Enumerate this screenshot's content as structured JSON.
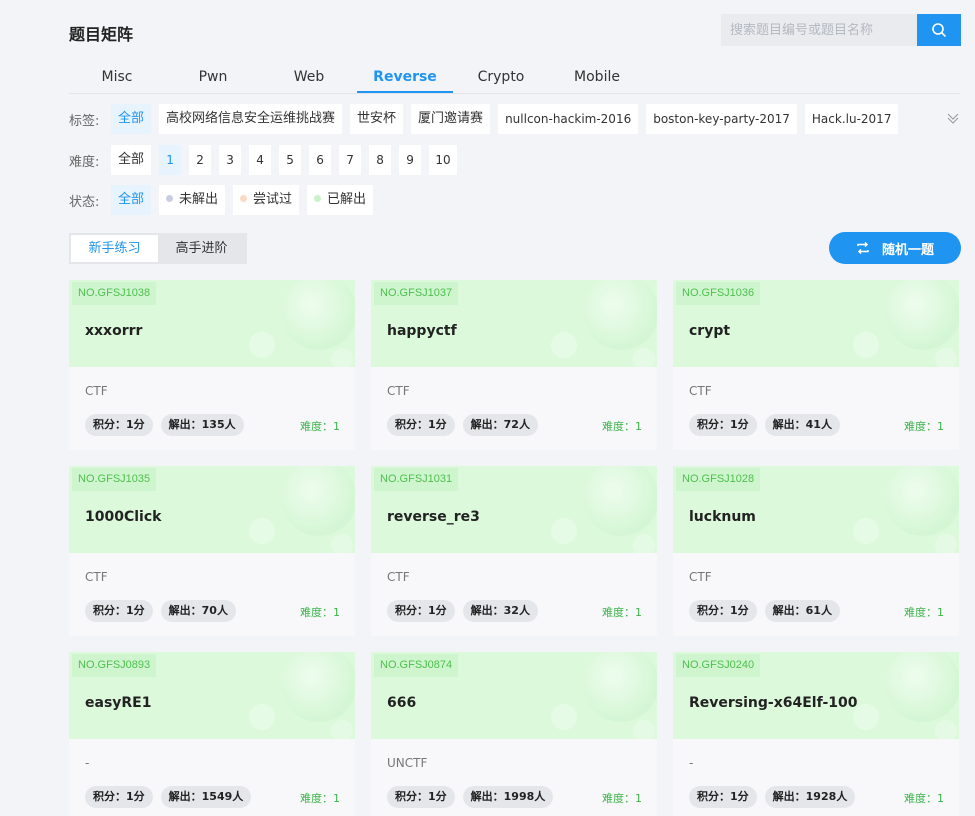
{
  "page_title": "题目矩阵",
  "search": {
    "placeholder": "搜索题目编号或题目名称"
  },
  "tabs": [
    "Misc",
    "Pwn",
    "Web",
    "Reverse",
    "Crypto",
    "Mobile"
  ],
  "active_tab": "Reverse",
  "filters": {
    "tags": {
      "label": "标签:",
      "items": [
        "全部",
        "高校网络信息安全运维挑战赛",
        "世安杯",
        "厦门邀请赛",
        "nullcon-hackim-2016",
        "boston-key-party-2017",
        "Hack.lu-2017"
      ]
    },
    "difficulty": {
      "label": "难度:",
      "items": [
        "全部",
        "1",
        "2",
        "3",
        "4",
        "5",
        "6",
        "7",
        "8",
        "9",
        "10"
      ]
    },
    "status": {
      "label": "状态:",
      "items": [
        "全部",
        "未解出",
        "尝试过",
        "已解出"
      ]
    }
  },
  "status_colors": [
    "#c8cde0",
    "#fbd9c2",
    "#c9f2c9"
  ],
  "level_toggle": [
    "新手练习",
    "高手进阶"
  ],
  "random_button": "随机一题",
  "colors": {
    "accent": "#1f95f1",
    "card_green": "#dcf9db",
    "difficulty_green": "#3bb34a"
  },
  "cards": [
    {
      "no": "NO.GFSJ1038",
      "name": "xxxorrr",
      "category": "CTF",
      "score": "积分：1分",
      "solved": "解出：135人",
      "difficulty": "难度：1"
    },
    {
      "no": "NO.GFSJ1037",
      "name": "happyctf",
      "category": "CTF",
      "score": "积分：1分",
      "solved": "解出：72人",
      "difficulty": "难度：1"
    },
    {
      "no": "NO.GFSJ1036",
      "name": "crypt",
      "category": "CTF",
      "score": "积分：1分",
      "solved": "解出：41人",
      "difficulty": "难度：1"
    },
    {
      "no": "NO.GFSJ1035",
      "name": "1000Click",
      "category": "CTF",
      "score": "积分：1分",
      "solved": "解出：70人",
      "difficulty": "难度：1"
    },
    {
      "no": "NO.GFSJ1031",
      "name": "reverse_re3",
      "category": "CTF",
      "score": "积分：1分",
      "solved": "解出：32人",
      "difficulty": "难度：1"
    },
    {
      "no": "NO.GFSJ1028",
      "name": "lucknum",
      "category": "CTF",
      "score": "积分：1分",
      "solved": "解出：61人",
      "difficulty": "难度：1"
    },
    {
      "no": "NO.GFSJ0893",
      "name": "easyRE1",
      "category": "-",
      "score": "积分：1分",
      "solved": "解出：1549人",
      "difficulty": "难度：1"
    },
    {
      "no": "NO.GFSJ0874",
      "name": "666",
      "category": "UNCTF",
      "score": "积分：1分",
      "solved": "解出：1998人",
      "difficulty": "难度：1"
    },
    {
      "no": "NO.GFSJ0240",
      "name": "Reversing-x64Elf-100",
      "category": "-",
      "score": "积分：1分",
      "solved": "解出：1928人",
      "difficulty": "难度：1"
    }
  ]
}
